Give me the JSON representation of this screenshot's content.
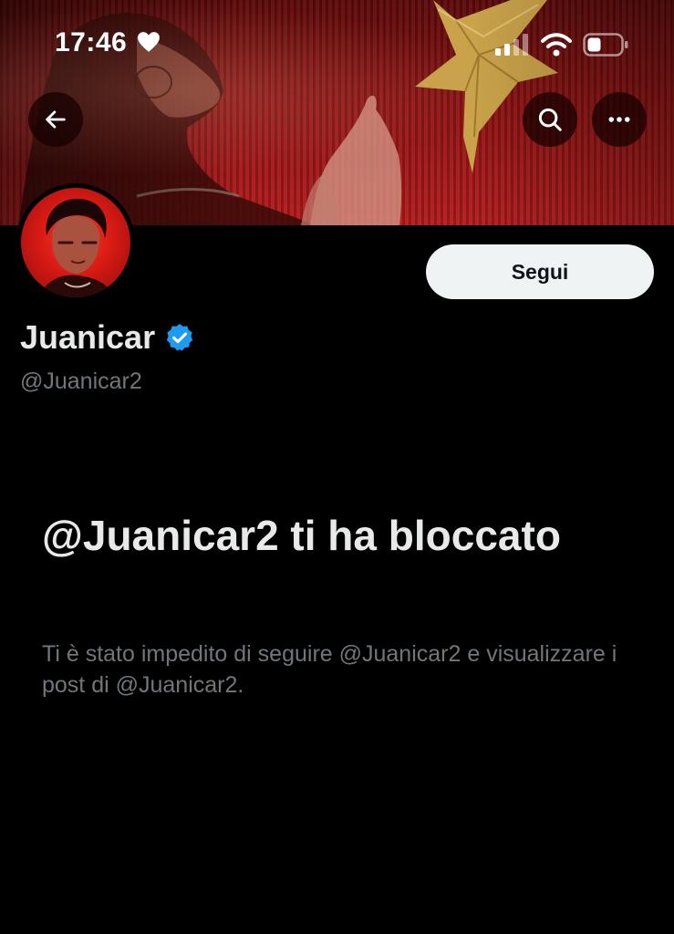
{
  "status_bar": {
    "time": "17:46"
  },
  "profile": {
    "display_name": "Juanicar",
    "handle": "@Juanicar2",
    "verified": true,
    "follow_label": "Segui"
  },
  "blocked": {
    "title": "@Juanicar2 ti ha bloccato",
    "description": "Ti è stato impedito di seguire @Juanicar2 e visualizzare i post di @Juanicar2."
  },
  "colors": {
    "background": "#000000",
    "verified_badge": "#1d9bf0",
    "follow_button_bg": "#eff3f4",
    "secondary_text": "#71767b",
    "banner_red": "#b51d1d",
    "star_gold": "#c9a24a"
  },
  "icons": {
    "back": "arrow-left-icon",
    "search": "search-icon",
    "more": "more-horizontal-icon",
    "verified": "verified-badge-icon",
    "heart": "heart-icon",
    "signal": "cellular-signal-icon",
    "wifi": "wifi-icon",
    "battery": "battery-icon"
  }
}
